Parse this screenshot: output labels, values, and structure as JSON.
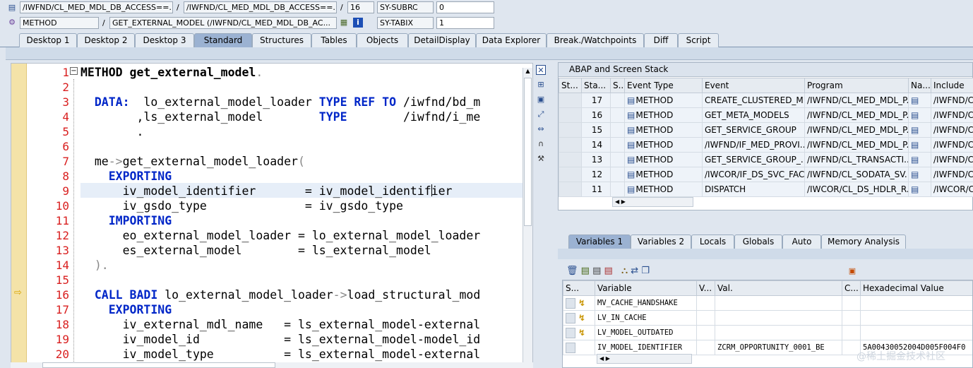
{
  "header": {
    "row1": {
      "field1": "/IWFND/CL_MED_MDL_DB_ACCESS==...",
      "field2": "/IWFND/CL_MED_MDL_DB_ACCESS==...",
      "line": "16",
      "sy_label": "SY-SUBRC",
      "sy_value": "0"
    },
    "row2": {
      "field1": "METHOD",
      "field2": "GET_EXTERNAL_MODEL (/IWFND/CL_MED_MDL_DB_AC...",
      "sy_label": "SY-TABIX",
      "sy_value": "1"
    },
    "sep": "/"
  },
  "tabs": [
    "Desktop 1",
    "Desktop 2",
    "Desktop 3",
    "Standard",
    "Structures",
    "Tables",
    "Objects",
    "DetailDisplay",
    "Data Explorer",
    "Break./Watchpoints",
    "Diff",
    "Script"
  ],
  "code": {
    "lines": [
      {
        "n": "1",
        "segs": [
          [
            "kw0",
            "METHOD "
          ],
          [
            "kw0",
            "get_external_model"
          ],
          [
            "p",
            "."
          ]
        ]
      },
      {
        "n": "2",
        "segs": []
      },
      {
        "n": "3",
        "segs": [
          [
            "t",
            "  "
          ],
          [
            "kw",
            "DATA:"
          ],
          [
            "t",
            "  lo_external_model_loader "
          ],
          [
            "kw",
            "TYPE REF TO"
          ],
          [
            "t",
            " /iwfnd/bd_m"
          ]
        ]
      },
      {
        "n": "4",
        "segs": [
          [
            "t",
            "        ,ls_external_model        "
          ],
          [
            "kw",
            "TYPE"
          ],
          [
            "t",
            "        /iwfnd/i_me"
          ]
        ]
      },
      {
        "n": "5",
        "segs": [
          [
            "t",
            "        ."
          ]
        ]
      },
      {
        "n": "6",
        "segs": []
      },
      {
        "n": "7",
        "segs": [
          [
            "t",
            "  me"
          ],
          [
            "p",
            "->"
          ],
          [
            "t",
            "get_external_model_loader"
          ],
          [
            "p",
            "("
          ]
        ]
      },
      {
        "n": "8",
        "segs": [
          [
            "t",
            "    "
          ],
          [
            "kw",
            "EXPORTING"
          ]
        ]
      },
      {
        "n": "9",
        "segs": [
          [
            "t",
            "      iv_model_identifier       = iv_model_identifier"
          ]
        ]
      },
      {
        "n": "10",
        "segs": [
          [
            "t",
            "      iv_gsdo_type              = iv_gsdo_type"
          ]
        ]
      },
      {
        "n": "11",
        "segs": [
          [
            "t",
            "    "
          ],
          [
            "kw",
            "IMPORTING"
          ]
        ]
      },
      {
        "n": "12",
        "segs": [
          [
            "t",
            "      eo_external_model_loader = lo_external_model_loader"
          ]
        ]
      },
      {
        "n": "13",
        "segs": [
          [
            "t",
            "      es_external_model        = ls_external_model"
          ]
        ]
      },
      {
        "n": "14",
        "segs": [
          [
            "t",
            "  "
          ],
          [
            "p",
            ")."
          ]
        ]
      },
      {
        "n": "15",
        "segs": []
      },
      {
        "n": "16",
        "segs": [
          [
            "t",
            "  "
          ],
          [
            "kw",
            "CALL BADI"
          ],
          [
            "t",
            " lo_external_model_loader"
          ],
          [
            "p",
            "->"
          ],
          [
            "t",
            "load_structural_mod"
          ]
        ]
      },
      {
        "n": "17",
        "segs": [
          [
            "t",
            "    "
          ],
          [
            "kw",
            "EXPORTING"
          ]
        ]
      },
      {
        "n": "18",
        "segs": [
          [
            "t",
            "      iv_external_mdl_name   = ls_external_model-external"
          ]
        ]
      },
      {
        "n": "19",
        "segs": [
          [
            "t",
            "      iv_model_id            = ls_external_model-model_id"
          ]
        ]
      },
      {
        "n": "20",
        "segs": [
          [
            "t",
            "      iv_model_type          = ls_external_model-external"
          ]
        ]
      }
    ]
  },
  "stack": {
    "title": "ABAP and Screen Stack",
    "columns": [
      "St...",
      "Sta...",
      "S...",
      "Event Type",
      "Event",
      "Program",
      "Na...",
      "Include"
    ],
    "rows": [
      {
        "level": "17",
        "type": "METHOD",
        "event": "CREATE_CLUSTERED_M...",
        "program": "/IWFND/CL_MED_MDL_P...",
        "include": "/IWFND/CL"
      },
      {
        "level": "16",
        "type": "METHOD",
        "event": "GET_META_MODELS",
        "program": "/IWFND/CL_MED_MDL_P...",
        "include": "/IWFND/CL"
      },
      {
        "level": "15",
        "type": "METHOD",
        "event": "GET_SERVICE_GROUP",
        "program": "/IWFND/CL_MED_MDL_P...",
        "include": "/IWFND/CL"
      },
      {
        "level": "14",
        "type": "METHOD",
        "event": "/IWFND/IF_MED_PROVI...",
        "program": "/IWFND/CL_MED_MDL_P...",
        "include": "/IWFND/CL"
      },
      {
        "level": "13",
        "type": "METHOD",
        "event": "GET_SERVICE_GROUP_...",
        "program": "/IWFND/CL_TRANSACTI...",
        "include": "/IWFND/CL"
      },
      {
        "level": "12",
        "type": "METHOD",
        "event": "/IWCOR/IF_DS_SVC_FAC...",
        "program": "/IWFND/CL_SODATA_SV...",
        "include": "/IWFND/CL"
      },
      {
        "level": "11",
        "type": "METHOD",
        "event": "DISPATCH",
        "program": "/IWCOR/CL_DS_HDLR_R...",
        "include": "/IWCOR/CL"
      }
    ]
  },
  "vartabs": [
    "Variables 1",
    "Variables 2",
    "Locals",
    "Globals",
    "Auto",
    "Memory Analysis"
  ],
  "vars": {
    "columns": [
      "S...",
      "Variable",
      "V...",
      "Val.",
      "C...",
      "Hexadecimal Value"
    ],
    "rows": [
      {
        "name": "MV_CACHE_HANDSHAKE",
        "val": "",
        "hex": ""
      },
      {
        "name": "LV_IN_CACHE",
        "val": "",
        "hex": ""
      },
      {
        "name": "LV_MODEL_OUTDATED",
        "val": "",
        "hex": ""
      },
      {
        "name": "IV_MODEL_IDENTIFIER",
        "val": "ZCRM_OPPORTUNITY_0001_BE",
        "hex": "5A00430052004D005F004F0"
      }
    ]
  },
  "watermark": "@稀土掘金技术社区",
  "colors": {
    "keyword": "#0026c8",
    "linenum": "#d92020",
    "active_tab": "#9bb2d2"
  }
}
